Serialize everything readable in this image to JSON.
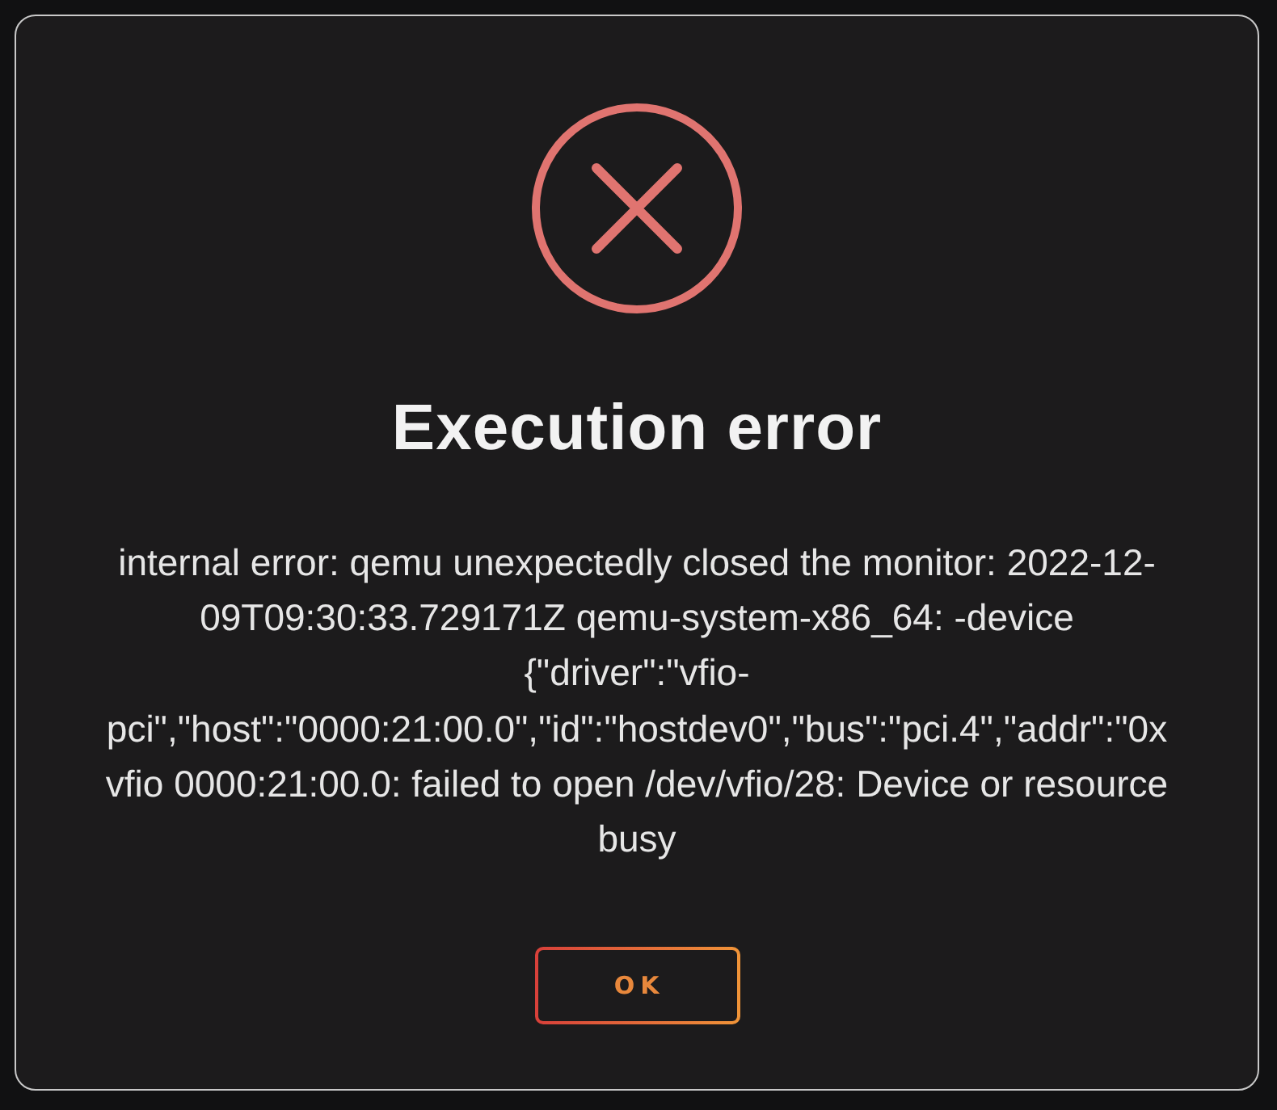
{
  "dialog": {
    "title": "Execution error",
    "message": "internal error: qemu unexpectedly closed the monitor: 2022-12-09T09:30:33.729171Z qemu-system-x86_64: -device {\"driver\":\"vfio-pci\",\"host\":\"0000:21:00.0\",\"id\":\"hostdev0\",\"bus\":\"pci.4\",\"addr\":\"0x vfio 0000:21:00.0: failed to open /dev/vfio/28: Device or resource busy",
    "buttons": [
      "OK"
    ]
  }
}
